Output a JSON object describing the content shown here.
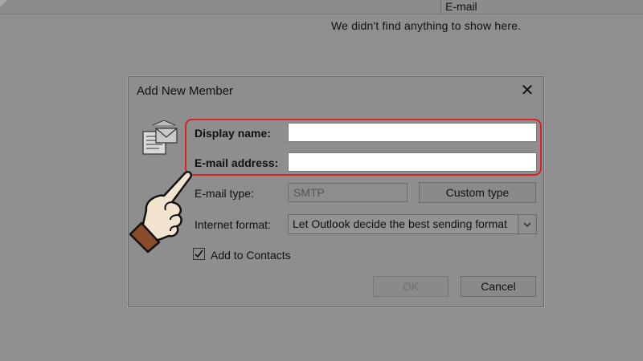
{
  "background": {
    "column_header": "E-mail",
    "empty_message": "We didn't find anything to show here."
  },
  "dialog": {
    "title": "Add New Member",
    "close_glyph": "✕",
    "display_name_label": "Display name:",
    "display_name_value": "",
    "email_address_label": "E-mail address:",
    "email_address_value": "",
    "email_type_label": "E-mail type:",
    "email_type_value": "SMTP",
    "custom_type_button": "Custom type",
    "internet_format_label": "Internet format:",
    "internet_format_value": "Let Outlook decide the best sending format",
    "add_to_contacts_label": "Add to Contacts",
    "add_to_contacts_checked": true,
    "ok_button": "OK",
    "cancel_button": "Cancel"
  },
  "colors": {
    "highlight": "#e01f1f",
    "hand_cuff": "#8a4b2b",
    "hand_skin": "#f3e4cf"
  }
}
